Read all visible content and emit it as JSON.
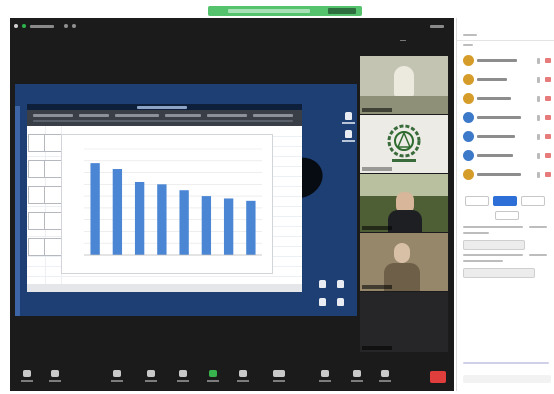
{
  "notification": {
    "text": "",
    "action_label": ""
  },
  "meeting": {
    "view_label": "",
    "top_right_label": ""
  },
  "shared_screen": {
    "spreadsheet_name": "",
    "chart_data": {
      "type": "bar",
      "title": "",
      "categories": [
        "",
        "",
        "",
        "",
        "",
        "",
        "",
        ""
      ],
      "values": [
        78,
        73,
        62,
        60,
        55,
        50,
        48,
        46
      ],
      "ylim": [
        0,
        90
      ],
      "bar_color": "#4a86d4",
      "grid": true,
      "legend": "none"
    }
  },
  "participants_tiles": [
    {
      "name": "",
      "video": "on"
    },
    {
      "name": "",
      "video": "logo"
    },
    {
      "name": "",
      "video": "on"
    },
    {
      "name": "",
      "video": "on"
    },
    {
      "name": "",
      "video": "off"
    }
  ],
  "toolbar": {
    "buttons": [
      "",
      "",
      "",
      "",
      "",
      "",
      "",
      "",
      "",
      "",
      ""
    ],
    "end_label": "",
    "end_color": "#e03d3d"
  },
  "panel": {
    "title": "",
    "participants": [
      {
        "name": "",
        "avatar_color": "#d59c2a"
      },
      {
        "name": "",
        "avatar_color": "#d59c2a"
      },
      {
        "name": "",
        "avatar_color": "#d59c2a"
      },
      {
        "name": "",
        "avatar_color": "#3c79c9"
      },
      {
        "name": "",
        "avatar_color": "#3c79c9"
      },
      {
        "name": "",
        "avatar_color": "#3c79c9"
      },
      {
        "name": "",
        "avatar_color": "#d59c2a"
      }
    ],
    "invite_label": "",
    "mute_all_label": "",
    "more_label": "",
    "chat_input_placeholder": ""
  },
  "colors": {
    "meeting_bg": "#1b1b1c",
    "share_bg": "#1e3f73",
    "notification_bg": "#55c26e",
    "avatar_orange": "#d59c2a"
  }
}
